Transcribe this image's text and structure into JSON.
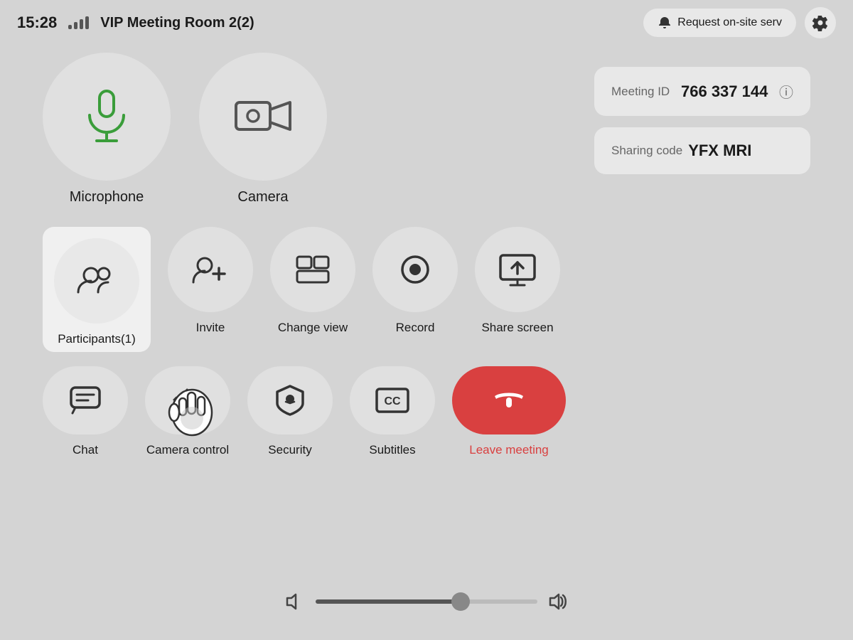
{
  "header": {
    "time": "15:28",
    "room_title": "VIP Meeting Room 2(2)",
    "request_btn_label": "Request on-site serv",
    "settings_icon": "gear-icon"
  },
  "meeting_info": {
    "meeting_id_label": "Meeting ID",
    "meeting_id_value": "766 337 144",
    "sharing_code_label": "Sharing code",
    "sharing_code_value": "YFX MRI"
  },
  "controls": {
    "microphone_label": "Microphone",
    "camera_label": "Camera",
    "participants_label": "Participants(1)",
    "invite_label": "Invite",
    "change_view_label": "Change view",
    "record_label": "Record",
    "share_screen_label": "Share screen",
    "chat_label": "Chat",
    "camera_control_label": "Camera control",
    "security_label": "Security",
    "subtitles_label": "Subtitles",
    "leave_label": "Leave meeting"
  },
  "volume": {
    "level": 65
  }
}
